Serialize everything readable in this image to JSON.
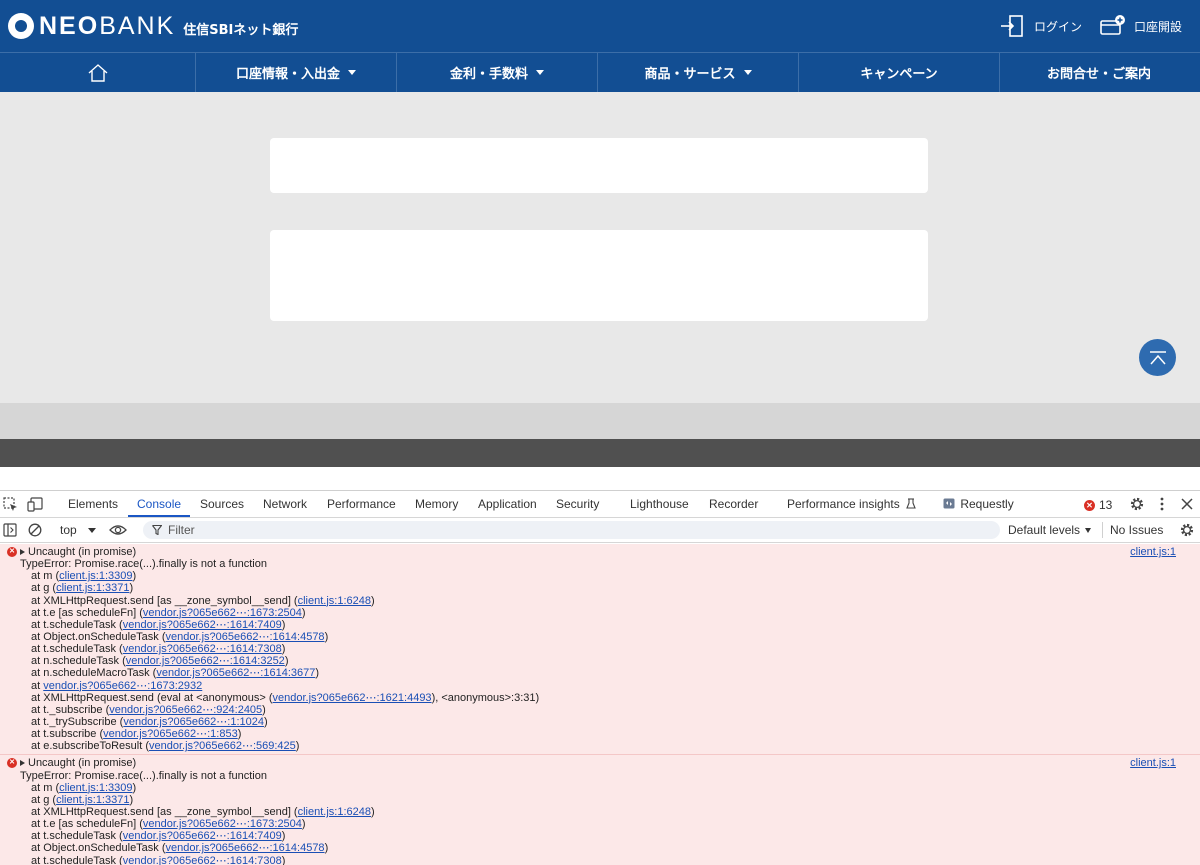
{
  "header": {
    "brand": "NEOBANK",
    "brand_bold": "NEO",
    "brand_rest": "BANK",
    "brand_sub": "住信SBIネット銀行",
    "login_label": "ログイン",
    "open_account_label": "口座開設"
  },
  "nav": {
    "items": [
      {
        "label": "",
        "icon": "home-icon"
      },
      {
        "label": "口座情報・入出金",
        "dropdown": true
      },
      {
        "label": "金利・手数料",
        "dropdown": true
      },
      {
        "label": "商品・サービス",
        "dropdown": true
      },
      {
        "label": "キャンペーン",
        "dropdown": false
      },
      {
        "label": "お問合せ・ご案内",
        "dropdown": false
      }
    ]
  },
  "devtools": {
    "tabs": [
      "Elements",
      "Console",
      "Sources",
      "Network",
      "Performance",
      "Memory",
      "Application",
      "Security",
      "Lighthouse",
      "Recorder",
      "Performance insights",
      "Requestly"
    ],
    "active_tab": "Console",
    "error_count": "13",
    "toolbar": {
      "context": "top",
      "filter_placeholder": "Filter",
      "levels": "Default levels",
      "issues": "No Issues"
    },
    "messages": [
      {
        "source": "client.js:1",
        "title": "Uncaught (in promise)",
        "error": "TypeError: Promise.race(...).finally is not a function",
        "stack": [
          {
            "pre": "at m (",
            "link": "client.js:1:3309",
            "post": ")"
          },
          {
            "pre": "at g (",
            "link": "client.js:1:3371",
            "post": ")"
          },
          {
            "pre": "at XMLHttpRequest.send [as __zone_symbol__send] (",
            "link": "client.js:1:6248",
            "post": ")"
          },
          {
            "pre": "at t.e [as scheduleFn] (",
            "link": "vendor.js?065e662⋯:1673:2504",
            "post": ")"
          },
          {
            "pre": "at t.scheduleTask (",
            "link": "vendor.js?065e662⋯:1614:7409",
            "post": ")"
          },
          {
            "pre": "at Object.onScheduleTask (",
            "link": "vendor.js?065e662⋯:1614:4578",
            "post": ")"
          },
          {
            "pre": "at t.scheduleTask (",
            "link": "vendor.js?065e662⋯:1614:7308",
            "post": ")"
          },
          {
            "pre": "at n.scheduleTask (",
            "link": "vendor.js?065e662⋯:1614:3252",
            "post": ")"
          },
          {
            "pre": "at n.scheduleMacroTask (",
            "link": "vendor.js?065e662⋯:1614:3677",
            "post": ")"
          },
          {
            "pre": "at ",
            "link": "vendor.js?065e662⋯:1673:2932",
            "post": ""
          },
          {
            "pre": "at XMLHttpRequest.send (eval at <anonymous> (",
            "link": "vendor.js?065e662⋯:1621:4493",
            "post": "), <anonymous>:3:31)"
          },
          {
            "pre": "at t._subscribe (",
            "link": "vendor.js?065e662⋯:924:2405",
            "post": ")"
          },
          {
            "pre": "at t._trySubscribe (",
            "link": "vendor.js?065e662⋯:1:1024",
            "post": ")"
          },
          {
            "pre": "at t.subscribe (",
            "link": "vendor.js?065e662⋯:1:853",
            "post": ")"
          },
          {
            "pre": "at e.subscribeToResult (",
            "link": "vendor.js?065e662⋯:569:425",
            "post": ")"
          }
        ]
      },
      {
        "source": "client.js:1",
        "title": "Uncaught (in promise)",
        "error": "TypeError: Promise.race(...).finally is not a function",
        "stack": [
          {
            "pre": "at m (",
            "link": "client.js:1:3309",
            "post": ")"
          },
          {
            "pre": "at g (",
            "link": "client.js:1:3371",
            "post": ")"
          },
          {
            "pre": "at XMLHttpRequest.send [as __zone_symbol__send] (",
            "link": "client.js:1:6248",
            "post": ")"
          },
          {
            "pre": "at t.e [as scheduleFn] (",
            "link": "vendor.js?065e662⋯:1673:2504",
            "post": ")"
          },
          {
            "pre": "at t.scheduleTask (",
            "link": "vendor.js?065e662⋯:1614:7409",
            "post": ")"
          },
          {
            "pre": "at Object.onScheduleTask (",
            "link": "vendor.js?065e662⋯:1614:4578",
            "post": ")"
          },
          {
            "pre": "at t.scheduleTask (",
            "link": "vendor.js?065e662⋯:1614:7308",
            "post": ")"
          }
        ]
      }
    ]
  }
}
